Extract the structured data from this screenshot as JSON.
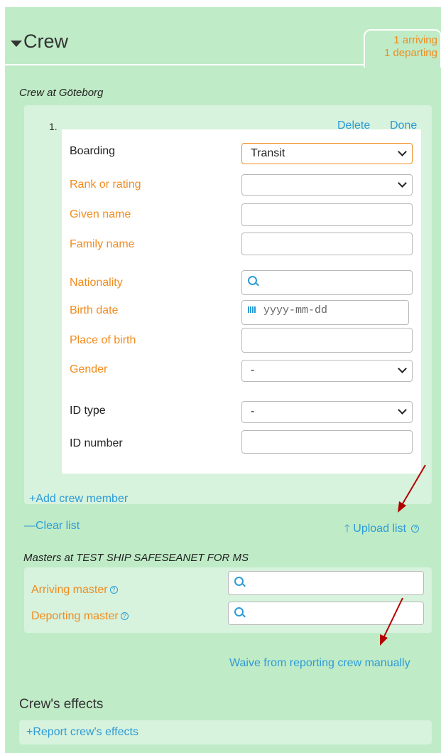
{
  "header": {
    "title": "Crew",
    "badge_arriving": "1 arriving",
    "badge_departing": "1 departing"
  },
  "crew_at": "Crew at Göteborg",
  "member": {
    "index": "1.",
    "delete_label": "Delete",
    "done_label": "Done",
    "fields": {
      "boarding": {
        "label": "Boarding",
        "value": "Transit"
      },
      "rank": {
        "label": "Rank or rating",
        "value": ""
      },
      "given_name": {
        "label": "Given name",
        "value": ""
      },
      "family_name": {
        "label": "Family name",
        "value": ""
      },
      "nationality": {
        "label": "Nationality",
        "value": ""
      },
      "birth_date": {
        "label": "Birth date",
        "placeholder": "yyyy-mm-dd"
      },
      "place_of_birth": {
        "label": "Place of birth",
        "value": ""
      },
      "gender": {
        "label": "Gender",
        "value": "-"
      },
      "id_type": {
        "label": "ID type",
        "value": "-"
      },
      "id_number": {
        "label": "ID number",
        "value": ""
      }
    }
  },
  "add_member": "+Add crew member",
  "clear_list": "—Clear list",
  "upload_list": "Upload list",
  "masters_title": "Masters at TEST SHIP SAFESEANET FOR MS",
  "arriving_master": "Arriving master",
  "departing_master": "Deporting master",
  "waive": "Waive from reporting crew manually",
  "effects_title": "Crew's effects",
  "report_effects": "+Report crew's effects",
  "colors": {
    "panel": "#bfebc7",
    "required": "#f08c1f",
    "link": "#2d9bd6",
    "annotation": "#b30000"
  },
  "icons": [
    "caret-down-icon",
    "search-icon",
    "calendar-icon",
    "help-icon",
    "upload-arrow-icon"
  ]
}
